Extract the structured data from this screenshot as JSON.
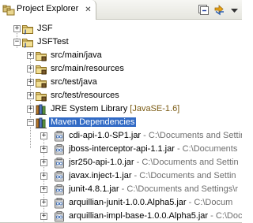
{
  "view": {
    "tab_title": "Project Explorer",
    "tab_icon": "project-explorer-icon",
    "close_glyph": "✕",
    "toolbar": [
      {
        "name": "collapse-all-button",
        "icon": "collapse-all-icon"
      },
      {
        "name": "link-with-editor-button",
        "icon": "link-with-editor-icon"
      }
    ]
  },
  "tree": {
    "nodes": [
      {
        "label": "JSF",
        "expander": "+",
        "icon": "project-icon",
        "indent": 0
      },
      {
        "label": "JSFTest",
        "expander": "−",
        "icon": "project-icon",
        "indent": 0
      },
      {
        "label": "src/main/java",
        "expander": "+",
        "icon": "source-folder-icon",
        "indent": 1
      },
      {
        "label": "src/main/resources",
        "expander": "+",
        "icon": "source-folder-icon",
        "indent": 1
      },
      {
        "label": "src/test/java",
        "expander": "+",
        "icon": "source-folder-icon",
        "indent": 1
      },
      {
        "label": "src/test/resources",
        "expander": "+",
        "icon": "source-folder-icon",
        "indent": 1
      },
      {
        "label": "JRE System Library",
        "decoration": "[JavaSE-1.6]",
        "expander": "+",
        "icon": "library-icon",
        "indent": 1
      },
      {
        "label": "Maven Dependencies",
        "expander": "−",
        "icon": "library-icon",
        "indent": 1,
        "selected": true
      },
      {
        "label": "cdi-api-1.0-SP1.jar",
        "path": " - C:\\Documents and Settin",
        "expander": "+",
        "icon": "jar-icon",
        "indent": 2
      },
      {
        "label": "jboss-interceptor-api-1.1.jar",
        "path": " - C:\\Documents",
        "expander": "+",
        "icon": "jar-icon",
        "indent": 2
      },
      {
        "label": "jsr250-api-1.0.jar",
        "path": " - C:\\Documents and Settin",
        "expander": "+",
        "icon": "jar-icon",
        "indent": 2
      },
      {
        "label": "javax.inject-1.jar",
        "path": " - C:\\Documents and Settin",
        "expander": "+",
        "icon": "jar-icon",
        "indent": 2
      },
      {
        "label": "junit-4.8.1.jar",
        "path": " - C:\\Documents and Settings\\r",
        "expander": "+",
        "icon": "jar-icon",
        "indent": 2
      },
      {
        "label": "arquillian-junit-1.0.0.Alpha5.jar",
        "path": " - C:\\Docum",
        "expander": "+",
        "icon": "jar-icon",
        "indent": 2
      },
      {
        "label": "arquillian-impl-base-1.0.0.Alpha5.jar",
        "path": " - C:\\Doc",
        "expander": "+",
        "icon": "jar-icon",
        "indent": 2
      }
    ]
  },
  "colors": {
    "selection": "#316ac5",
    "decoration": "#7a5a12",
    "path": "#6e6e6e"
  }
}
